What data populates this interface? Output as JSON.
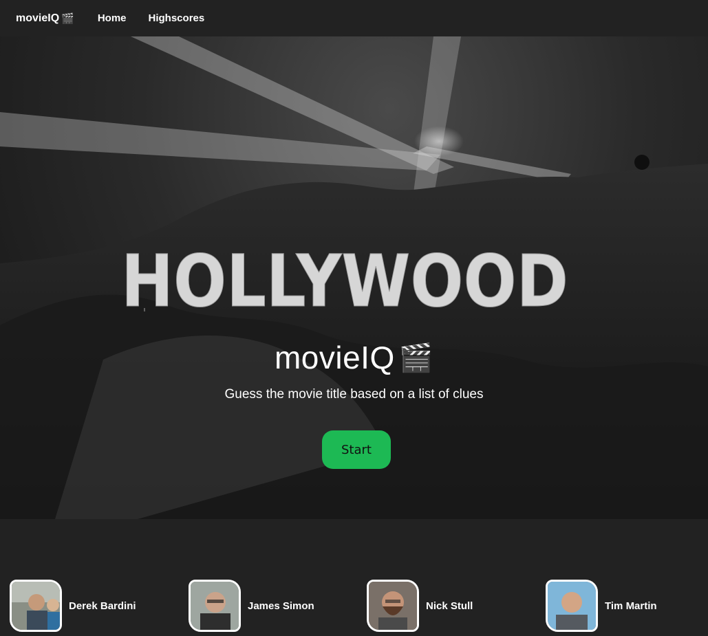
{
  "nav": {
    "brand": "movieIQ",
    "brand_icon": "clapperboard-icon",
    "links": [
      {
        "label": "Home"
      },
      {
        "label": "Highscores"
      }
    ]
  },
  "hero": {
    "title": "movieIQ",
    "title_icon": "clapperboard-icon",
    "subtitle": "Guess the movie title based on a list of clues",
    "start_label": "Start",
    "start_color": "#1db954",
    "background_sign": "HOLLYWOOD"
  },
  "team": {
    "members": [
      {
        "name": "Derek Bardini"
      },
      {
        "name": "James Simon"
      },
      {
        "name": "Nick Stull"
      },
      {
        "name": "Tim Martin"
      }
    ]
  }
}
